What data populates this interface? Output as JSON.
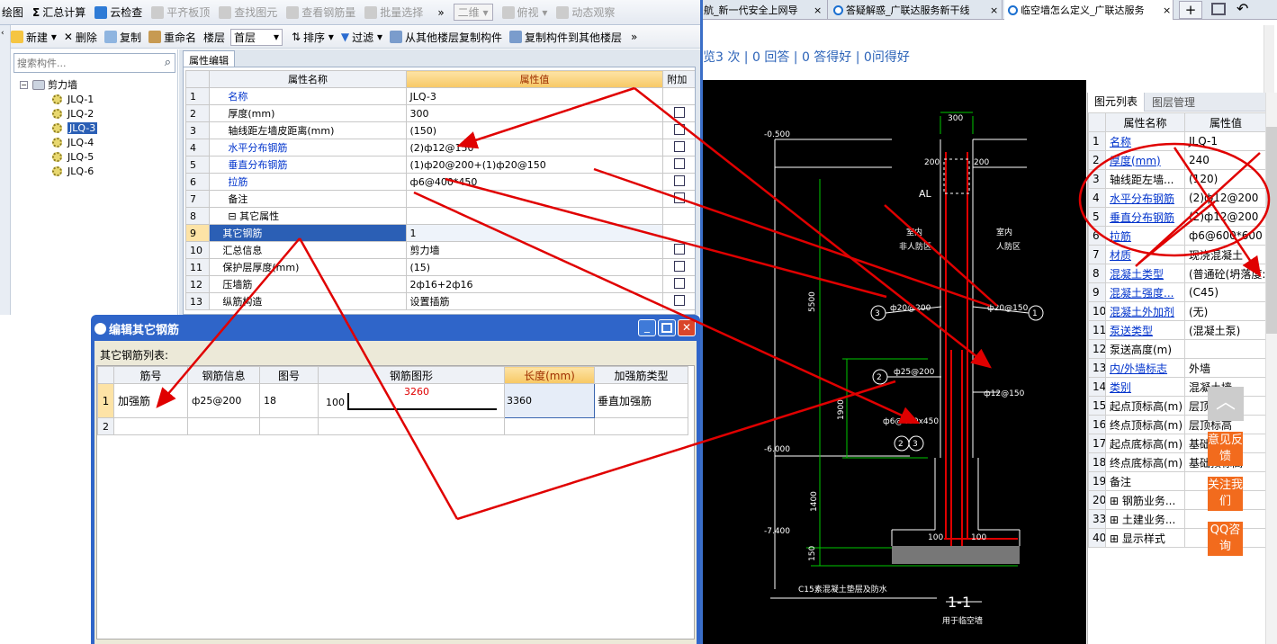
{
  "toolbar1": {
    "items": [
      "绘图",
      "汇总计算",
      "云检查",
      "平齐板顶",
      "查找图元",
      "查看钢筋量",
      "批量选择"
    ],
    "more": "»",
    "view_select": "二维",
    "view2": "俯视",
    "view3": "动态观察"
  },
  "tabs": [
    "航_新一代安全上网导",
    "答疑解惑_广联达服务新干线",
    "临空墙怎么定义_广联达服务"
  ],
  "toolbar2": {
    "items": [
      "新建",
      "删除",
      "复制",
      "重命名"
    ],
    "floor_label": "楼层",
    "floor_value": "首层",
    "sort": "排序",
    "filter": "过滤",
    "copy_from": "从其他楼层复制构件",
    "copy_to": "复制构件到其他楼层",
    "more": "»"
  },
  "search": {
    "placeholder": "搜索构件..."
  },
  "tree": {
    "root": "剪力墙",
    "items": [
      "JLQ-1",
      "JLQ-2",
      "JLQ-3",
      "JLQ-4",
      "JLQ-5",
      "JLQ-6"
    ],
    "selected": 2
  },
  "prop_editor": {
    "tab": "属性编辑",
    "headers": [
      "属性名称",
      "属性值",
      "附加"
    ],
    "rows": [
      {
        "n": "1",
        "name": "名称",
        "value": "JLQ-3",
        "blue": true,
        "cb": false
      },
      {
        "n": "2",
        "name": "厚度(mm)",
        "value": "300",
        "blue": false,
        "cb": true
      },
      {
        "n": "3",
        "name": "轴线距左墙皮距离(mm)",
        "value": "(150)",
        "blue": false,
        "cb": true
      },
      {
        "n": "4",
        "name": "水平分布钢筋",
        "value": "(2)ф12@150",
        "blue": true,
        "cb": true
      },
      {
        "n": "5",
        "name": "垂直分布钢筋",
        "value": "(1)ф20@200+(1)ф20@150",
        "blue": true,
        "cb": true
      },
      {
        "n": "6",
        "name": "拉筋",
        "value": "ф6@400*450",
        "blue": true,
        "cb": true
      },
      {
        "n": "7",
        "name": "备注",
        "value": "",
        "blue": false,
        "cb": true
      },
      {
        "n": "8",
        "name": "⊟ 其它属性",
        "value": "",
        "blue": false,
        "cb": false
      },
      {
        "n": "9",
        "name": "其它钢筋",
        "value": "1",
        "blue": false,
        "cb": false
      },
      {
        "n": "10",
        "name": "汇总信息",
        "value": "剪力墙",
        "blue": false,
        "cb": true
      },
      {
        "n": "11",
        "name": "保护层厚度(mm)",
        "value": "(15)",
        "blue": false,
        "cb": true
      },
      {
        "n": "12",
        "name": "压墙筋",
        "value": "2ф16+2ф16",
        "blue": false,
        "cb": true
      },
      {
        "n": "13",
        "name": "纵筋构造",
        "value": "设置插筋",
        "blue": false,
        "cb": true
      }
    ]
  },
  "dialog": {
    "title": "编辑其它钢筋",
    "list_label": "其它钢筋列表:",
    "headers": [
      "筋号",
      "钢筋信息",
      "图号",
      "钢筋图形",
      "长度(mm)",
      "加强筋类型"
    ],
    "row1": {
      "n": "1",
      "name": "加强筋",
      "info": "ф25@200",
      "fig": "18",
      "shape_left": "100",
      "shape_len": "3260",
      "length": "3360",
      "type": "垂直加强筋"
    },
    "row2": {
      "n": "2"
    }
  },
  "qa": {
    "stats": "览3 次 | 0 回答 | 0 答得好 | 0问得好"
  },
  "drawing": {
    "texts": {
      "t300": "300",
      "t200a": "200",
      "t200b": "200",
      "al": "AL",
      "lev1": "-0.500",
      "lev2": "-6.000",
      "lev3": "-7.400",
      "room_l1": "室内",
      "room_l2": "非人防区",
      "room_r1": "室内",
      "room_r2": "人防区",
      "n5500": "5500",
      "n1900": "1900",
      "n1400": "1400",
      "n150": "150",
      "r3": "ф20@200",
      "r1": "ф20@150",
      "r2": "ф25@200",
      "r4": "ф12@150",
      "r5": "ф6@400x450",
      "b100a": "100",
      "b100b": "100",
      "note": "C15素混凝土垫层及防水",
      "sec": "1-1",
      "sub": "用于临空墙",
      "c1": "1",
      "c2": "2",
      "c3": "3",
      "c23a": "2",
      "c23b": "3"
    }
  },
  "right_panel": {
    "tabs": [
      "图元列表",
      "图层管理"
    ],
    "headers": [
      "属性名称",
      "属性值"
    ],
    "rows": [
      {
        "n": "1",
        "name": "名称",
        "value": "JLQ-1",
        "blue": true
      },
      {
        "n": "2",
        "name": "厚度(mm)",
        "value": "240",
        "blue": true
      },
      {
        "n": "3",
        "name": "轴线距左墙...",
        "value": "(120)",
        "blue": false
      },
      {
        "n": "4",
        "name": "水平分布钢筋",
        "value": "(2)ф12@200",
        "blue": true
      },
      {
        "n": "5",
        "name": "垂直分布钢筋",
        "value": "(2)ф12@200",
        "blue": true
      },
      {
        "n": "6",
        "name": "拉筋",
        "value": "ф6@600*600",
        "blue": true
      },
      {
        "n": "7",
        "name": "材质",
        "value": "现浇混凝土",
        "blue": true
      },
      {
        "n": "8",
        "name": "混凝土类型",
        "value": "(普通砼(坍落度:",
        "blue": true
      },
      {
        "n": "9",
        "name": "混凝土强度...",
        "value": "(C45)",
        "blue": true
      },
      {
        "n": "10",
        "name": "混凝土外加剂",
        "value": "(无)",
        "blue": true
      },
      {
        "n": "11",
        "name": "泵送类型",
        "value": "(混凝土泵)",
        "blue": true
      },
      {
        "n": "12",
        "name": "泵送高度(m)",
        "value": "",
        "blue": false
      },
      {
        "n": "13",
        "name": "内/外墙标志",
        "value": "外墙",
        "blue": true
      },
      {
        "n": "14",
        "name": "类别",
        "value": "混凝土墙",
        "blue": true
      },
      {
        "n": "15",
        "name": "起点顶标高(m)",
        "value": "层顶标高",
        "blue": false
      },
      {
        "n": "16",
        "name": "终点顶标高(m)",
        "value": "层顶标高",
        "blue": false
      },
      {
        "n": "17",
        "name": "起点底标高(m)",
        "value": "基础顶标高",
        "blue": false
      },
      {
        "n": "18",
        "name": "终点底标高(m)",
        "value": "基础顶标高",
        "blue": false
      },
      {
        "n": "19",
        "name": "备注",
        "value": "",
        "blue": false
      },
      {
        "n": "20",
        "name": "⊞ 钢筋业务...",
        "value": "",
        "blue": false
      },
      {
        "n": "33",
        "name": "⊞ 土建业务...",
        "value": "",
        "blue": false
      },
      {
        "n": "40",
        "name": "⊞ 显示样式",
        "value": "",
        "blue": false
      }
    ]
  },
  "side": {
    "top": "︿",
    "b1": "意见反馈",
    "b2": "关注我们",
    "b3": "QQ咨询"
  }
}
